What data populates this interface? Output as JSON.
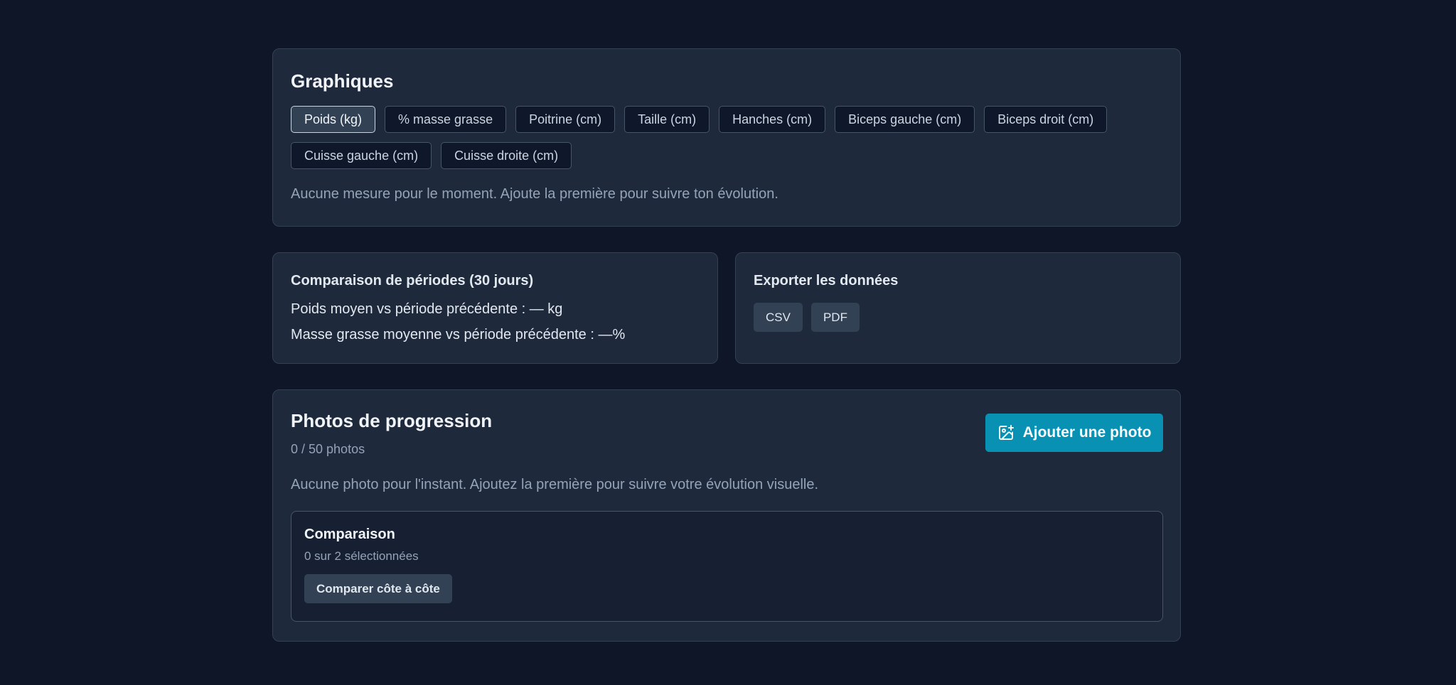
{
  "charts": {
    "title": "Graphiques",
    "metrics": [
      {
        "label": "Poids (kg)",
        "active": true
      },
      {
        "label": "% masse grasse",
        "active": false
      },
      {
        "label": "Poitrine (cm)",
        "active": false
      },
      {
        "label": "Taille (cm)",
        "active": false
      },
      {
        "label": "Hanches (cm)",
        "active": false
      },
      {
        "label": "Biceps gauche (cm)",
        "active": false
      },
      {
        "label": "Biceps droit (cm)",
        "active": false
      },
      {
        "label": "Cuisse gauche (cm)",
        "active": false
      },
      {
        "label": "Cuisse droite (cm)",
        "active": false
      }
    ],
    "empty_message": "Aucune mesure pour le moment. Ajoute la première pour suivre ton évolution."
  },
  "period_comparison": {
    "title": "Comparaison de périodes (30 jours)",
    "weight_line": "Poids moyen vs période précédente : — kg",
    "fat_line": "Masse grasse moyenne vs période précédente : —%"
  },
  "export": {
    "title": "Exporter les données",
    "csv_label": "CSV",
    "pdf_label": "PDF"
  },
  "photos": {
    "title": "Photos de progression",
    "count": "0 / 50 photos",
    "add_label": "Ajouter une photo",
    "add_icon": "image-plus-icon",
    "empty_message": "Aucune photo pour l'instant. Ajoutez la première pour suivre votre évolution visuelle.",
    "comparison": {
      "title": "Comparaison",
      "selected": "0 sur 2 sélectionnées",
      "button_label": "Comparer côte à côte"
    }
  },
  "colors": {
    "background": "#0e1628",
    "card": "#1e293b",
    "accent": "#0891b2"
  }
}
